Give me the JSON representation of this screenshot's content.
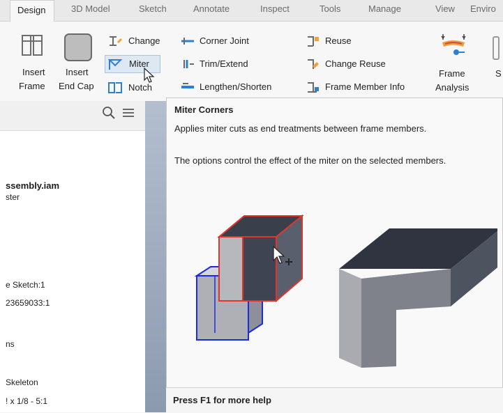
{
  "tabs": [
    "Design",
    "3D Model",
    "Sketch",
    "Annotate",
    "Inspect",
    "Tools",
    "Manage",
    "View",
    "Enviro"
  ],
  "ribbon": {
    "insert_frame": [
      "Insert",
      "Frame"
    ],
    "insert_end_cap": [
      "Insert",
      "End Cap"
    ],
    "change": "Change",
    "miter": "Miter",
    "notch": "Notch",
    "corner_joint": "Corner Joint",
    "trim_extend": "Trim/Extend",
    "lengthen_shorten": "Lengthen/Shorten",
    "reuse": "Reuse",
    "change_reuse": "Change Reuse",
    "frame_member_info": "Frame Member Info",
    "frame_analysis": [
      "Frame",
      "Analysis"
    ],
    "cut_off_s": "S"
  },
  "browser": {
    "items": [
      "ssembly.iam",
      "ster",
      "e Sketch:1",
      "23659033:1",
      "ns",
      "Skeleton",
      "! x 1/8 - 5:1"
    ]
  },
  "tooltip": {
    "title": "Miter Corners",
    "description": "Applies miter cuts as end treatments between frame members.",
    "options_text": "The options control the effect of the miter on the selected members.",
    "footer": "Press F1 for more help"
  },
  "colors": {
    "highlight_red": "#e0352b",
    "highlight_blue": "#1a2be0",
    "accent": "#0078d7"
  }
}
